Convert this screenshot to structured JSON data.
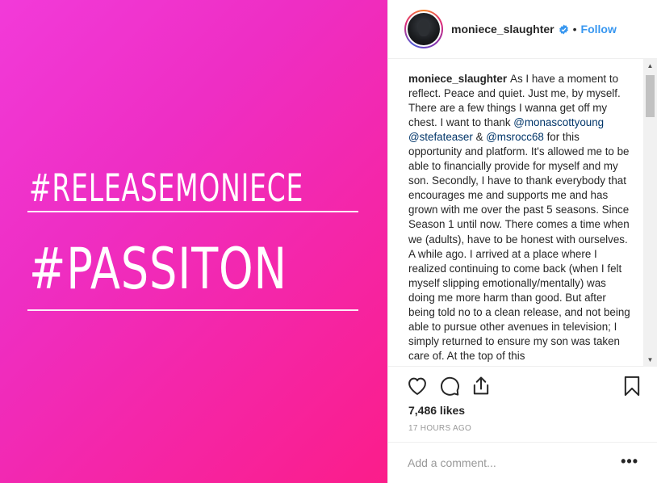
{
  "media": {
    "hashtag_1": "#RELEASEMONIECE",
    "hashtag_2": "#PASSITON"
  },
  "header": {
    "username": "moniece_slaughter",
    "separator": "•",
    "follow_label": "Follow"
  },
  "caption": {
    "username": "moniece_slaughter",
    "part1": "As I have a moment to reflect. Peace and quiet. Just me, by myself. There are a few things I wanna get off my chest. I want to thank ",
    "mention1": "@monascottyoung",
    "space1": " ",
    "mention2": "@stefateaser",
    "part2": " & ",
    "mention3": "@msrocc68",
    "part3": " for this opportunity and platform. It's allowed me to be able to financially provide for myself and my son. Secondly, I have to thank everybody that encourages me and supports me and has grown with me over the past 5 seasons. Since Season 1 until now. There comes a time when we (adults), have to be honest with ourselves. A while ago. I arrived at a place where I realized continuing to come back (when I felt myself slipping emotionally/mentally) was doing me more harm than good. But after being told no to a clean release, and not being able to pursue other avenues in television; I simply returned to ensure my son was taken care of. At the top of this"
  },
  "actions": {
    "like_icon": "heart-icon",
    "comment_icon": "comment-icon",
    "share_icon": "share-icon",
    "save_icon": "bookmark-icon"
  },
  "likes": "7,486 likes",
  "timestamp": "17 HOURS AGO",
  "comment": {
    "placeholder": "Add a comment...",
    "more_label": "•••"
  },
  "colors": {
    "link": "#3897f0",
    "mention": "#003569",
    "media_bg_start": "#f23ad9",
    "media_bg_end": "#fb1d8a"
  }
}
